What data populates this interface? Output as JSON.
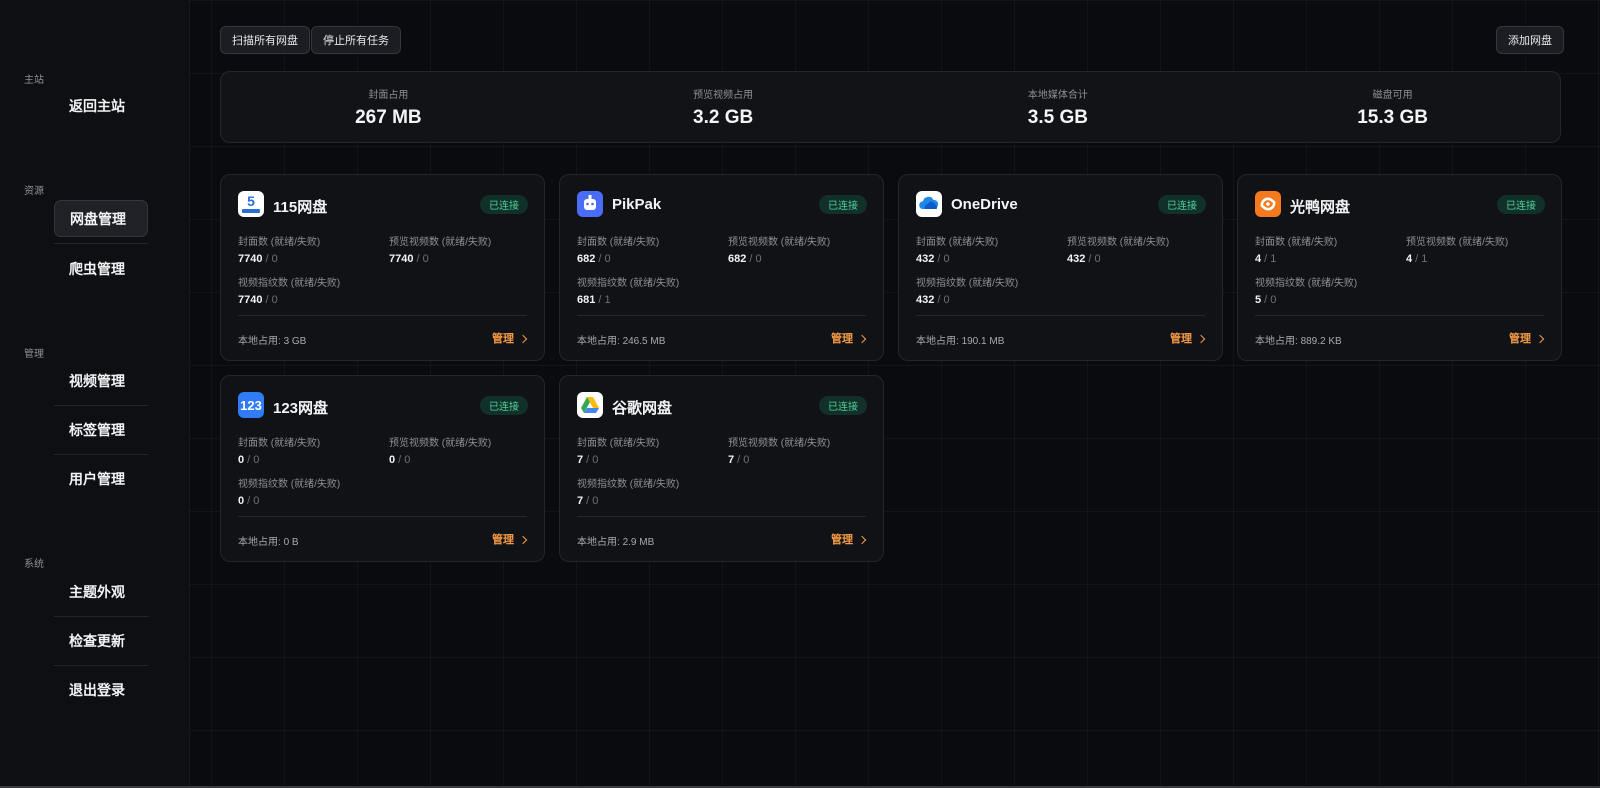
{
  "sidebar": {
    "sections": [
      {
        "label": "主站",
        "items": [
          {
            "label": "返回主站",
            "active": false
          }
        ]
      },
      {
        "label": "资源",
        "items": [
          {
            "label": "网盘管理",
            "active": true
          },
          {
            "label": "爬虫管理",
            "active": false
          }
        ]
      },
      {
        "label": "管理",
        "items": [
          {
            "label": "视频管理",
            "active": false
          },
          {
            "label": "标签管理",
            "active": false
          },
          {
            "label": "用户管理",
            "active": false
          }
        ]
      },
      {
        "label": "系统",
        "items": [
          {
            "label": "主题外观",
            "active": false
          },
          {
            "label": "检查更新",
            "active": false
          },
          {
            "label": "退出登录",
            "active": false
          }
        ]
      }
    ]
  },
  "toolbar": {
    "scan_all_label": "扫描所有网盘",
    "stop_all_label": "停止所有任务",
    "add_drive_label": "添加网盘"
  },
  "stats": [
    {
      "label": "封面占用",
      "value": "267 MB"
    },
    {
      "label": "预览视频占用",
      "value": "3.2 GB"
    },
    {
      "label": "本地媒体合计",
      "value": "3.5 GB"
    },
    {
      "label": "磁盘可用",
      "value": "15.3 GB"
    }
  ],
  "card_labels": {
    "cover": "封面数 (就绪/失败)",
    "preview": "预览视频数 (就绪/失败)",
    "fingerprint": "视频指纹数 (就绪/失败)",
    "usage_prefix": "本地占用: ",
    "manage": "管理",
    "separator": " / "
  },
  "drives": [
    {
      "name": "115网盘",
      "icon": "drive-115-icon",
      "status": "已连接",
      "cover_ok": "7740",
      "cover_fail": "0",
      "preview_ok": "7740",
      "preview_fail": "0",
      "fp_ok": "7740",
      "fp_fail": "0",
      "usage": "3 GB"
    },
    {
      "name": "PikPak",
      "icon": "pikpak-icon",
      "status": "已连接",
      "cover_ok": "682",
      "cover_fail": "0",
      "preview_ok": "682",
      "preview_fail": "0",
      "fp_ok": "681",
      "fp_fail": "1",
      "usage": "246.5 MB"
    },
    {
      "name": "OneDrive",
      "icon": "onedrive-cloud-icon",
      "status": "已连接",
      "cover_ok": "432",
      "cover_fail": "0",
      "preview_ok": "432",
      "preview_fail": "0",
      "fp_ok": "432",
      "fp_fail": "0",
      "usage": "190.1 MB"
    },
    {
      "name": "光鸭网盘",
      "icon": "guangya-icon",
      "status": "已连接",
      "cover_ok": "4",
      "cover_fail": "1",
      "preview_ok": "4",
      "preview_fail": "1",
      "fp_ok": "5",
      "fp_fail": "0",
      "usage": "889.2 KB"
    },
    {
      "name": "123网盘",
      "icon": "drive-123-icon",
      "status": "已连接",
      "cover_ok": "0",
      "cover_fail": "0",
      "preview_ok": "0",
      "preview_fail": "0",
      "fp_ok": "0",
      "fp_fail": "0",
      "usage": "0 B"
    },
    {
      "name": "谷歌网盘",
      "icon": "google-drive-icon",
      "status": "已连接",
      "cover_ok": "7",
      "cover_fail": "0",
      "preview_ok": "7",
      "preview_fail": "0",
      "fp_ok": "7",
      "fp_fail": "0",
      "usage": "2.9 MB"
    }
  ],
  "colors": {
    "accent": "#f59a45",
    "connected": "#4fd39a",
    "background": "#0a0b0e"
  }
}
